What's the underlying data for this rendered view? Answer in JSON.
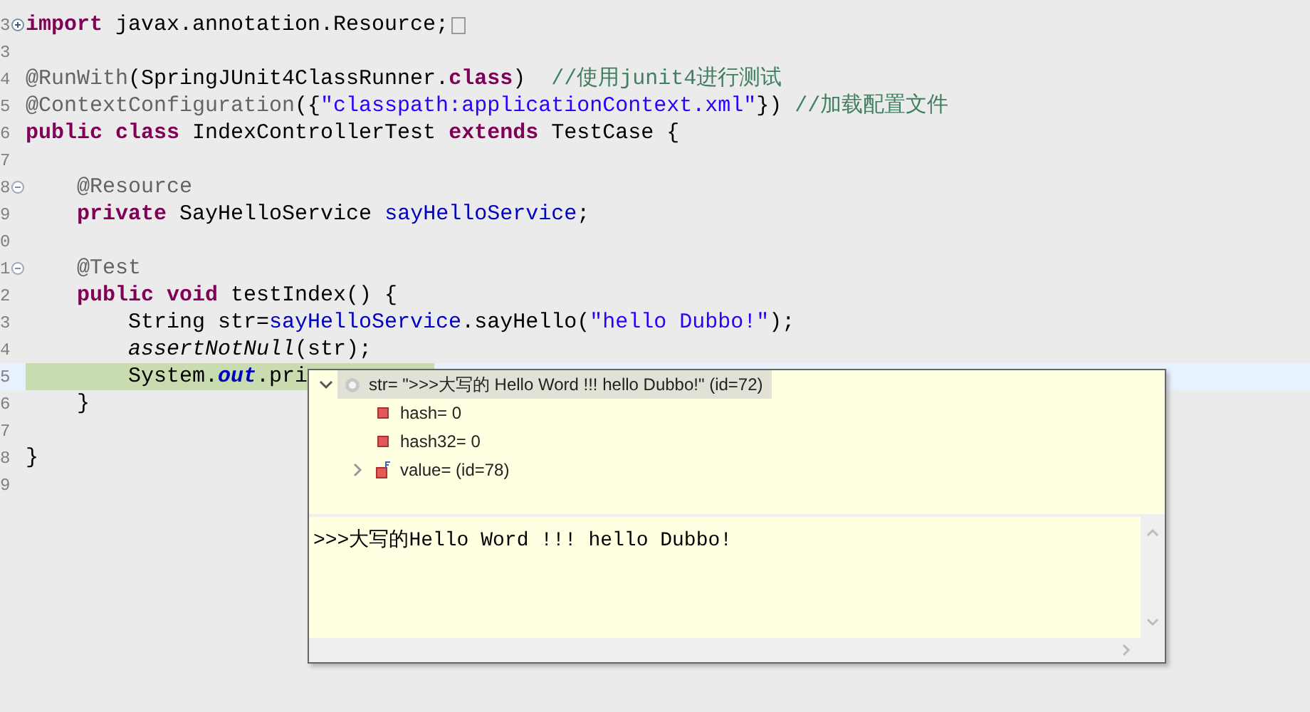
{
  "editor": {
    "lines": [
      {
        "number": "3",
        "current": false,
        "folded": true,
        "tokens": [
          {
            "kind": "keyword",
            "text": "import"
          },
          {
            "kind": "plain",
            "text": " javax.annotation.Resource;"
          }
        ]
      },
      {
        "number": "3",
        "current": false
      },
      {
        "number": "4",
        "current": false,
        "tokens": [
          {
            "kind": "annotation",
            "text": "@RunWith"
          },
          {
            "kind": "plain",
            "text": "(SpringJUnit4ClassRunner."
          },
          {
            "kind": "keyword",
            "text": "class"
          },
          {
            "kind": "plain",
            "text": ")  "
          },
          {
            "kind": "comment",
            "text": "//使用junit4进行测试"
          }
        ]
      },
      {
        "number": "5",
        "current": false,
        "tokens": [
          {
            "kind": "annotation",
            "text": "@ContextConfiguration"
          },
          {
            "kind": "plain",
            "text": "({"
          },
          {
            "kind": "string",
            "text": "\"classpath:applicationContext.xml\""
          },
          {
            "kind": "plain",
            "text": "}) "
          },
          {
            "kind": "comment",
            "text": "//加载配置文件"
          }
        ]
      },
      {
        "number": "6",
        "current": false,
        "tokens": [
          {
            "kind": "keyword",
            "text": "public class"
          },
          {
            "kind": "plain",
            "text": " IndexControllerTest "
          },
          {
            "kind": "keyword",
            "text": "extends"
          },
          {
            "kind": "plain",
            "text": " TestCase {"
          }
        ]
      },
      {
        "number": "7",
        "current": false
      },
      {
        "number": "8",
        "current": false,
        "folded": false,
        "tokens": [
          {
            "kind": "annotation",
            "text": "    @Resource"
          }
        ]
      },
      {
        "number": "9",
        "current": false,
        "tokens": [
          {
            "kind": "keyword",
            "text": "    private"
          },
          {
            "kind": "plain",
            "text": " SayHelloService "
          },
          {
            "kind": "field",
            "text": "sayHelloService"
          },
          {
            "kind": "plain",
            "text": ";"
          }
        ]
      },
      {
        "number": "0",
        "current": false
      },
      {
        "number": "1",
        "current": false,
        "folded": false,
        "tokens": [
          {
            "kind": "annotation",
            "text": "    @Test"
          }
        ]
      },
      {
        "number": "2",
        "current": false,
        "tokens": [
          {
            "kind": "keyword",
            "text": "    public void"
          },
          {
            "kind": "plain",
            "text": " testIndex() {"
          }
        ]
      },
      {
        "number": "3",
        "current": false,
        "tokens": [
          {
            "kind": "plain",
            "text": "        String str="
          },
          {
            "kind": "field",
            "text": "sayHelloService"
          },
          {
            "kind": "plain",
            "text": ".sayHello("
          },
          {
            "kind": "string",
            "text": "\"hello Dubbo!\""
          },
          {
            "kind": "plain",
            "text": ");"
          }
        ]
      },
      {
        "number": "4",
        "current": false,
        "tokens": [
          {
            "kind": "method_static",
            "text": "        assertNotNull"
          },
          {
            "kind": "plain",
            "text": "(str);"
          }
        ]
      },
      {
        "number": "5",
        "current": true,
        "tokens": [
          {
            "kind": "plain",
            "text": "        System."
          },
          {
            "kind": "field_static",
            "text": "out"
          },
          {
            "kind": "plain",
            "text": ".pri"
          }
        ]
      },
      {
        "number": "6",
        "current": false,
        "tokens": [
          {
            "kind": "plain",
            "text": "    }"
          }
        ]
      },
      {
        "number": "7",
        "current": false
      },
      {
        "number": "8",
        "current": false,
        "tokens": [
          {
            "kind": "plain",
            "text": "}"
          }
        ]
      },
      {
        "number": "9",
        "current": false
      }
    ]
  },
  "inspect_popup": {
    "tree": [
      {
        "label": "str= \">>>大写的 Hello Word !!! hello Dubbo!\" (id=72)",
        "kind": "object",
        "expanded": true,
        "selected": true,
        "children": [
          {
            "label": "hash= 0",
            "kind": "field",
            "selected": false
          },
          {
            "label": "hash32= 0",
            "kind": "field",
            "selected": false
          },
          {
            "label": "value= (id=78)",
            "kind": "final_field",
            "expanded": false,
            "selected": false
          }
        ]
      }
    ],
    "detail": ">>>大写的Hello Word !!! hello Dubbo!"
  }
}
